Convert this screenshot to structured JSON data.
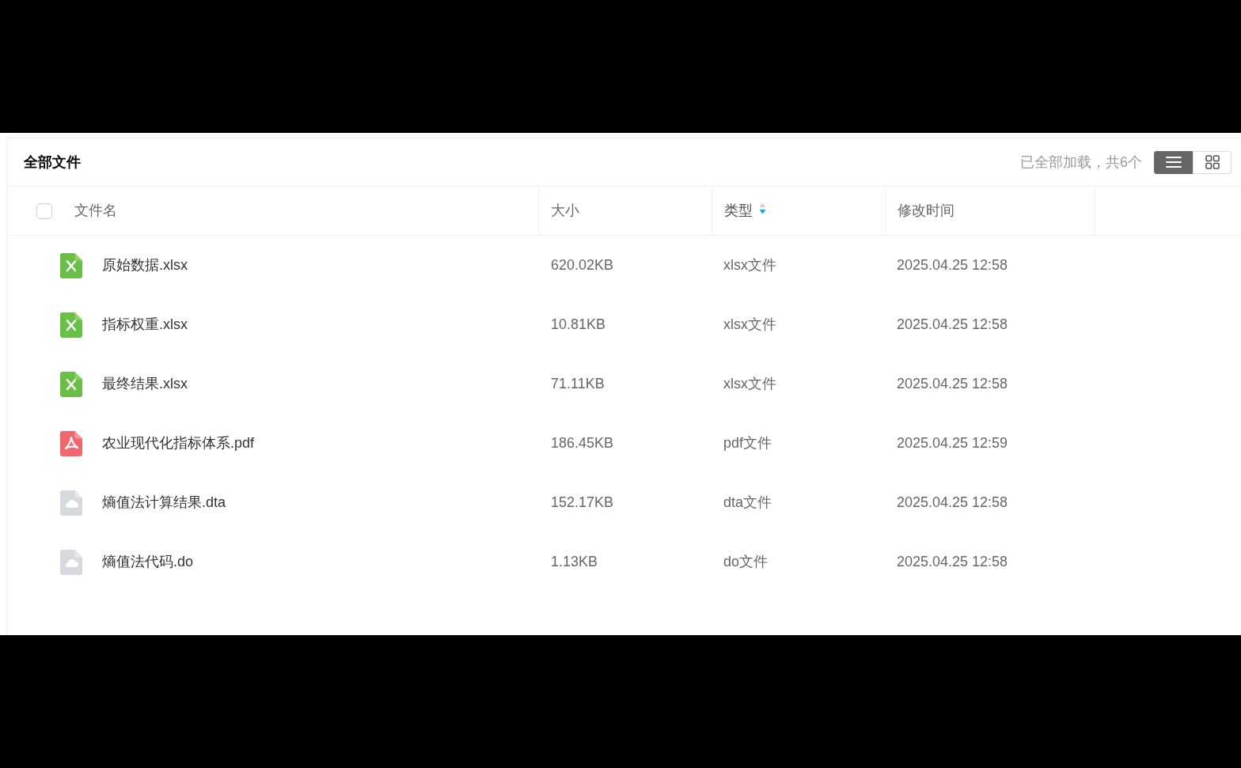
{
  "header": {
    "title": "全部文件",
    "load_status": "已全部加载，共6个",
    "view_modes": [
      {
        "kind": "list",
        "selected": true
      },
      {
        "kind": "grid",
        "selected": false
      }
    ]
  },
  "table": {
    "select_all": {
      "checked": false
    },
    "columns": [
      {
        "label": "文件名",
        "sorted": false
      },
      {
        "label": "大小",
        "sorted": false
      },
      {
        "label": "类型",
        "sorted": true,
        "descending": true
      },
      {
        "label": "修改时间",
        "sorted": false
      }
    ],
    "rows": [
      {
        "kind": "excel",
        "name": "原始数据.xlsx",
        "size": "620.02KB",
        "type": "xlsx文件",
        "modified": "2025.04.25 12:58"
      },
      {
        "kind": "excel",
        "name": "指标权重.xlsx",
        "size": "10.81KB",
        "type": "xlsx文件",
        "modified": "2025.04.25 12:58"
      },
      {
        "kind": "excel",
        "name": "最终结果.xlsx",
        "size": "71.11KB",
        "type": "xlsx文件",
        "modified": "2025.04.25 12:58"
      },
      {
        "kind": "pdf",
        "name": "农业现代化指标体系.pdf",
        "size": "186.45KB",
        "type": "pdf文件",
        "modified": "2025.04.25 12:59"
      },
      {
        "kind": "other",
        "name": "熵值法计算结果.dta",
        "size": "152.17KB",
        "type": "dta文件",
        "modified": "2025.04.25 12:58"
      },
      {
        "kind": "other",
        "name": "熵值法代码.do",
        "size": "1.13KB",
        "type": "do文件",
        "modified": "2025.04.25 12:58"
      }
    ]
  }
}
